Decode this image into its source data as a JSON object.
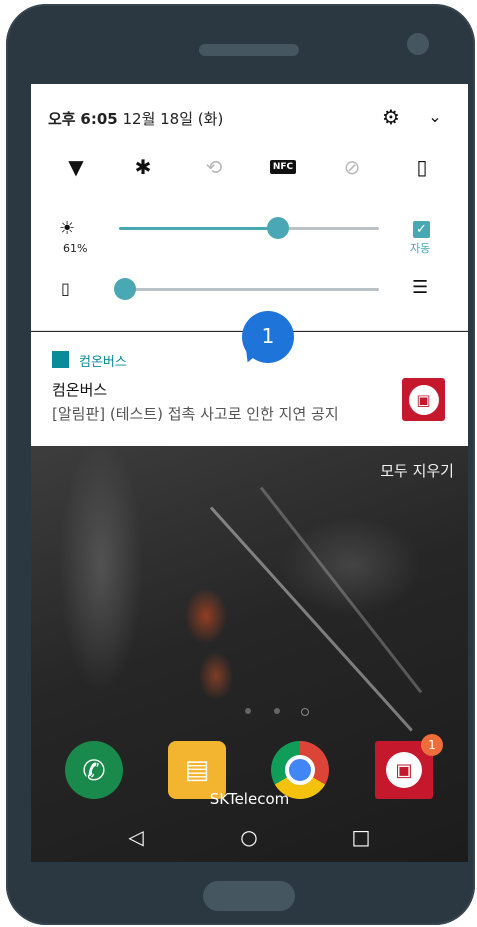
{
  "status": {
    "period": "오후",
    "time": "6:05",
    "date": "12월 18일 (화)"
  },
  "quick_settings": {
    "tiles": [
      {
        "icon": "wifi-icon",
        "glyph": "▼",
        "active": true
      },
      {
        "icon": "bluetooth-icon",
        "glyph": "✱",
        "active": true
      },
      {
        "icon": "auto-rotate-icon",
        "glyph": "⟲",
        "active": false
      },
      {
        "icon": "nfc-icon",
        "glyph": "NFC",
        "active": true
      },
      {
        "icon": "do-not-disturb-icon",
        "glyph": "⊘",
        "active": false
      },
      {
        "icon": "vibrate-icon",
        "glyph": "▮",
        "active": true
      }
    ],
    "brightness_percent_label": "61%",
    "brightness_level": 0.61,
    "auto_label": "자동",
    "volume_level": 0.0
  },
  "notification": {
    "app_name": "컴온버스",
    "title": "컴온버스",
    "body": "[알림판] (테스트) 접촉 사고로 인한 지연 공지",
    "annotation_number": "1",
    "accent_color": "#0a8b9a",
    "badge_color": "#c5182d"
  },
  "home": {
    "clear_all": "모두 지우기",
    "carrier": "SKTelecom",
    "dock": [
      "phone-icon",
      "messages-icon",
      "chrome-icon",
      "bus-app-icon"
    ],
    "bus_badge_count": "1"
  },
  "navbar": {
    "back": "◁",
    "home": "○",
    "recents": "□"
  }
}
